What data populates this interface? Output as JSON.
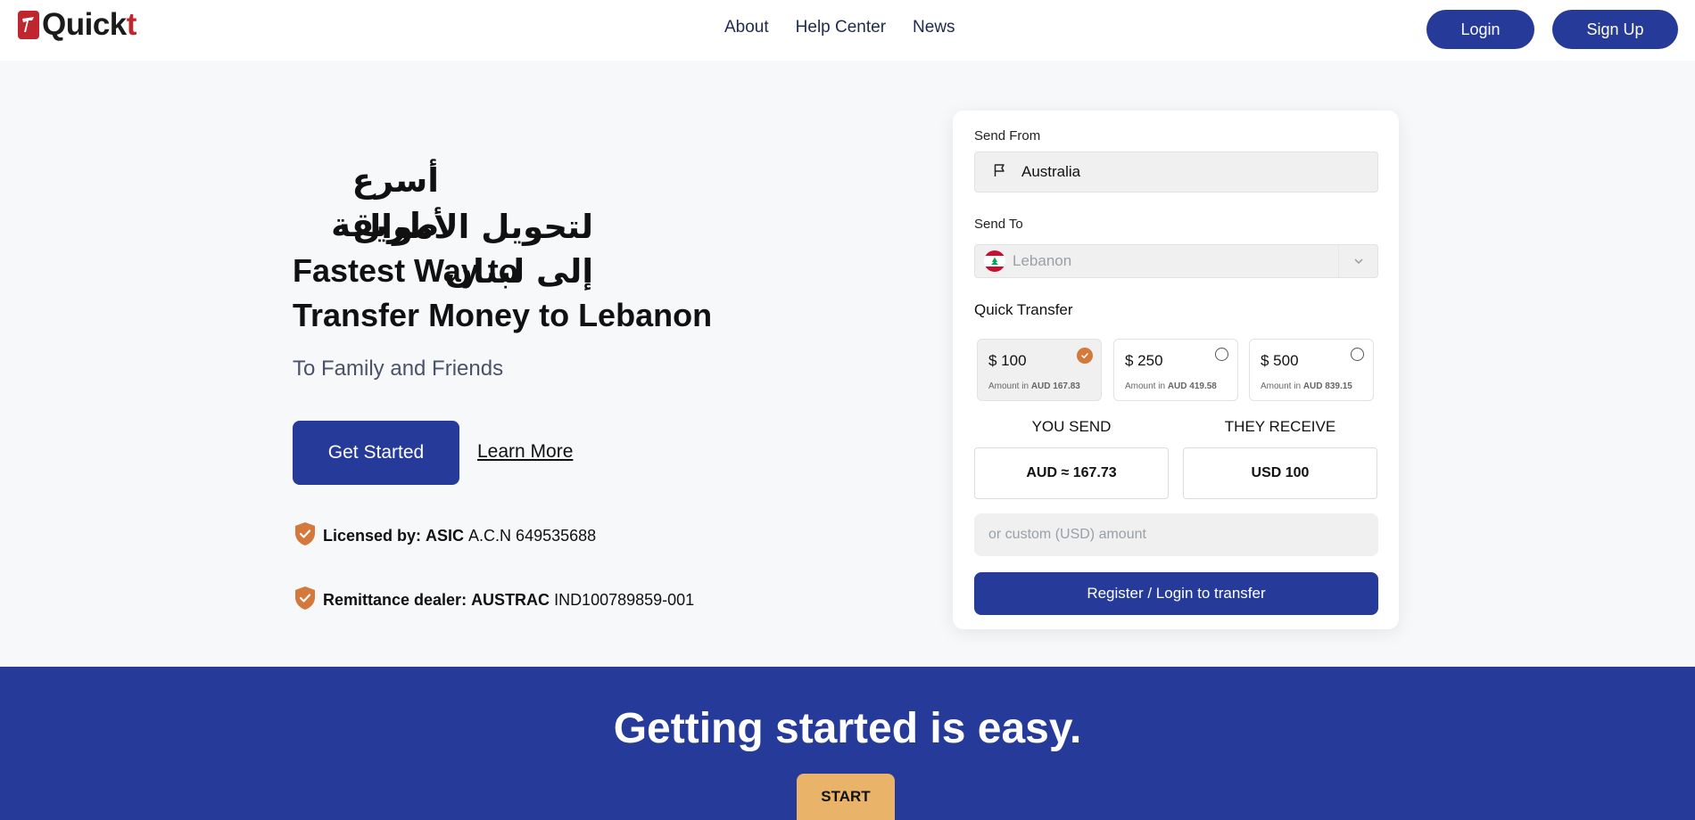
{
  "brand": {
    "name_main": "Quick",
    "name_accent": "t"
  },
  "nav": {
    "about": "About",
    "help": "Help Center",
    "news": "News"
  },
  "auth": {
    "login": "Login",
    "signup": "Sign Up"
  },
  "hero": {
    "arabic_line1": "أسرع طريقة",
    "arabic_line2": "لتحويل الأموال إلى لبنان",
    "title_line1": "Fastest Way to",
    "title_line2": "Transfer Money to Lebanon",
    "subtitle": "To Family and Friends",
    "cta": "Get Started",
    "learn_more": "Learn More"
  },
  "licenses": [
    {
      "label": "Licensed by:",
      "authority": "ASIC",
      "number": "A.C.N 649535688"
    },
    {
      "label": "Remittance dealer:",
      "authority": "AUSTRAC",
      "number": "IND100789859-001"
    }
  ],
  "transfer": {
    "send_from_label": "Send From",
    "send_from_value": "Australia",
    "send_to_label": "Send To",
    "send_to_value": "Lebanon",
    "quick_transfer_label": "Quick Transfer",
    "options": [
      {
        "amount": "$ 100",
        "aud_prefix": "Amount in ",
        "aud": "AUD 167.83",
        "selected": true
      },
      {
        "amount": "$ 250",
        "aud_prefix": "Amount in ",
        "aud": "AUD 419.58",
        "selected": false
      },
      {
        "amount": "$ 500",
        "aud_prefix": "Amount in ",
        "aud": "AUD 839.15",
        "selected": false
      }
    ],
    "you_send_label": "YOU SEND",
    "they_receive_label": "THEY RECEIVE",
    "you_send_value": "AUD ≈ 167.73",
    "they_receive_value": "USD 100",
    "custom_placeholder": "or custom (USD) amount",
    "submit": "Register / Login to transfer"
  },
  "band": {
    "title": "Getting started is easy.",
    "start": "START"
  },
  "colors": {
    "primary": "#263a99",
    "accent_orange": "#d4783c",
    "brand_red": "#c0262d",
    "start_button": "#e9b46a"
  },
  "icons": [
    "flag-icon",
    "lebanon-flag-icon",
    "chevron-down-icon",
    "shield-check-icon",
    "check-icon"
  ]
}
